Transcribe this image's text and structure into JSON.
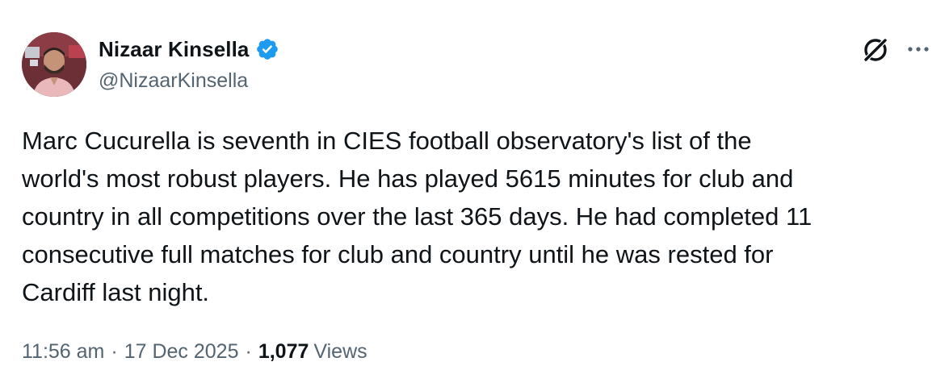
{
  "author": {
    "display_name": "Nizaar Kinsella",
    "handle": "@NizaarKinsella",
    "verified": true
  },
  "tweet": {
    "text": "Marc Cucurella is seventh in CIES football observatory's list of the\nworld's most robust players. He has played 5615 minutes for club and\ncountry in all competitions over the last 365 days. He had completed 11\nconsecutive full matches for club and country until he was rested for\nCardiff last night."
  },
  "meta": {
    "time": "11:56 am",
    "separator": "·",
    "date": "17 Dec 2025",
    "views_count": "1,077",
    "views_label": "Views"
  },
  "icons": {
    "verified": "verified-badge-icon",
    "grok": "grok-icon",
    "more": "more-options-icon"
  },
  "colors": {
    "text_primary": "#0f1419",
    "text_secondary": "#536471",
    "verified_blue": "#1d9bf0",
    "background": "#ffffff"
  }
}
